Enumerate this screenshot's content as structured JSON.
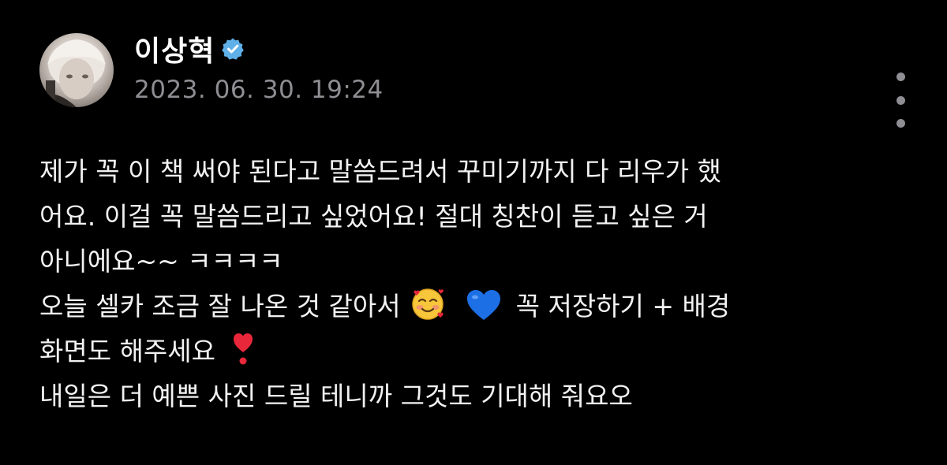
{
  "author": {
    "name": "이상혁",
    "verified": true,
    "avatar_icon": "avatar-photo"
  },
  "post": {
    "timestamp": "2023. 06. 30. 19:24",
    "body": {
      "line1": "제가 꼭 이 책 써야 된다고 말씀드려서 꾸미기까지 다 리우가 했",
      "line2": "어요. 이걸 꼭 말씀드리고 싶었어요! 절대 칭찬이 듣고 싶은 거",
      "line3": "아니에요~~ ㅋㅋㅋㅋ",
      "line4a": "오늘 셀카 조금 잘 나온 것 같아서",
      "line4b": "꼭 저장하기 + 배경",
      "line5": "화면도 해주세요",
      "line6": "내일은 더 예쁜 사진 드릴 테니까 그것도 기대해 줘요오"
    },
    "emojis": [
      "smiling-face-with-hearts",
      "blue-heart",
      "heart-exclamation"
    ]
  },
  "colors": {
    "background": "#000000",
    "text": "#f2f2f2",
    "muted": "#8e8e93",
    "verified": "#5fb0e8"
  }
}
